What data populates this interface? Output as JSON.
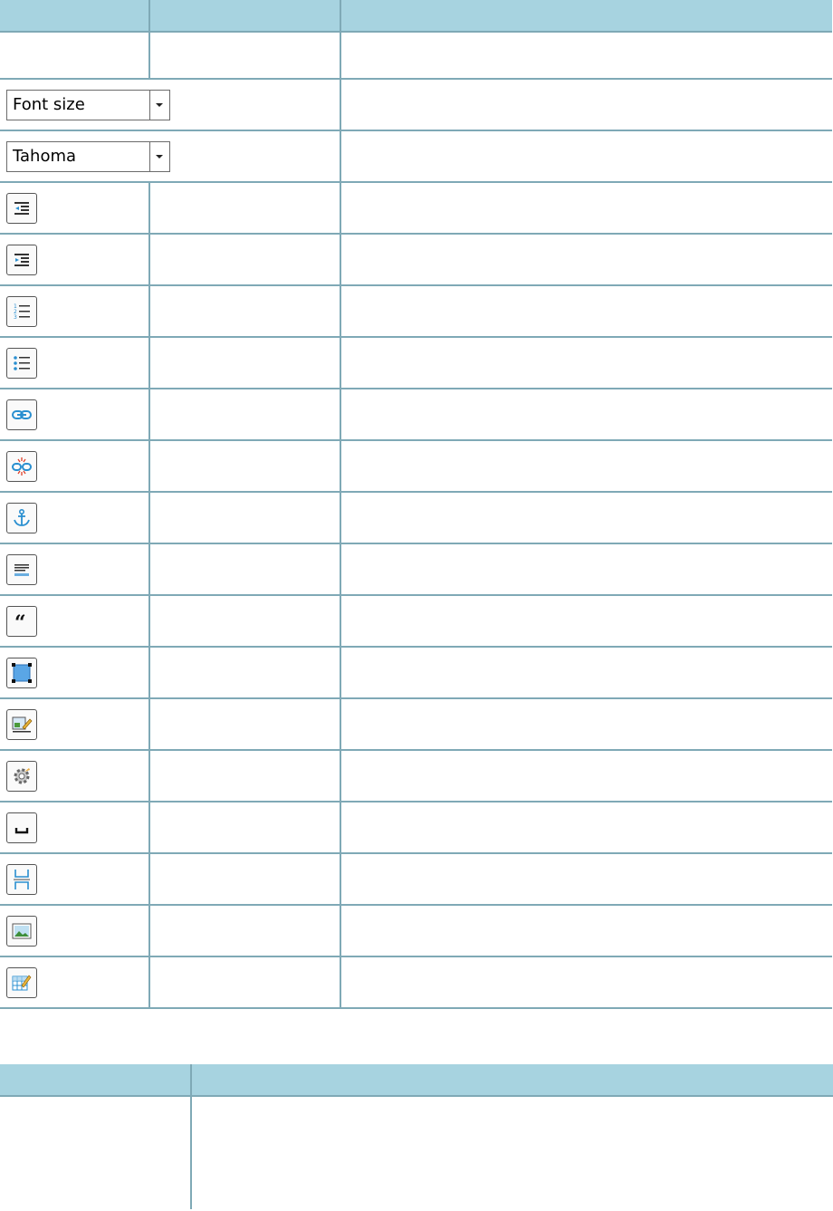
{
  "toolbar_table": {
    "font_size_combo": {
      "value": "Font size",
      "icon": "chevron-down-icon"
    },
    "font_family_combo": {
      "value": "Tahoma",
      "icon": "chevron-down-icon"
    },
    "icons": [
      "outdent-icon",
      "indent-icon",
      "numbered-list-icon",
      "bulleted-list-icon",
      "link-icon",
      "unlink-icon",
      "anchor-icon",
      "align-icon",
      "blockquote-icon",
      "div-container-icon",
      "edit-image-icon",
      "properties-gear-icon",
      "non-breaking-space-icon",
      "page-break-icon",
      "image-icon",
      "table-properties-icon"
    ]
  },
  "colors": {
    "header_bg": "#a7d3e0",
    "border": "#7fa9b6"
  }
}
